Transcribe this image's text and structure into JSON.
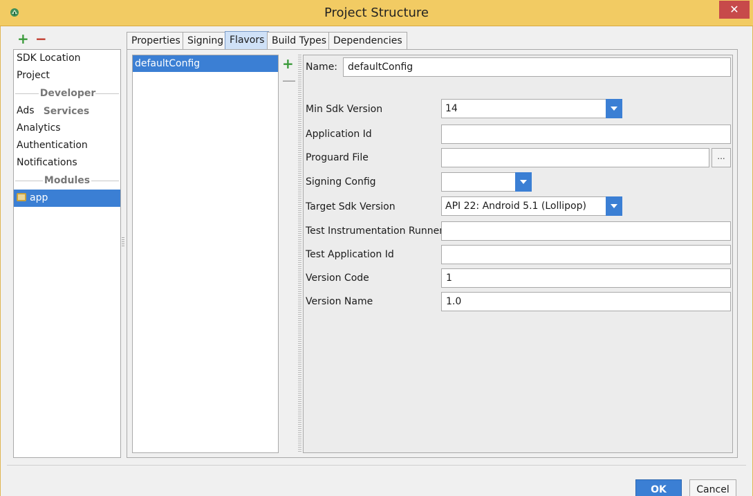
{
  "window": {
    "title": "Project Structure",
    "close_label": "✕"
  },
  "toolbar": {
    "add_label": "+",
    "remove_label": "−"
  },
  "nav": {
    "items": [
      {
        "label": "SDK Location"
      },
      {
        "label": "Project"
      }
    ],
    "section_developer": "Developer Services",
    "services": [
      {
        "label": "Ads"
      },
      {
        "label": "Analytics"
      },
      {
        "label": "Authentication"
      },
      {
        "label": "Notifications"
      }
    ],
    "section_modules": "Modules",
    "modules": [
      {
        "label": "app",
        "selected": true
      }
    ]
  },
  "tabs": [
    {
      "label": "Properties"
    },
    {
      "label": "Signing"
    },
    {
      "label": "Flavors",
      "active": true
    },
    {
      "label": "Build Types"
    },
    {
      "label": "Dependencies"
    }
  ],
  "flavors": {
    "items": [
      {
        "label": "defaultConfig",
        "selected": true
      }
    ],
    "add_label": "+",
    "remove_label": "—"
  },
  "form": {
    "name_label": "Name:",
    "name_value": "defaultConfig",
    "min_sdk_label": "Min Sdk Version",
    "min_sdk_value": "14",
    "app_id_label": "Application Id",
    "app_id_value": "",
    "proguard_label": "Proguard File",
    "proguard_value": "",
    "browse_label": "...",
    "signing_label": "Signing Config",
    "signing_value": "",
    "target_sdk_label": "Target Sdk Version",
    "target_sdk_value": "API 22: Android 5.1 (Lollipop)",
    "test_runner_label": "Test Instrumentation Runner",
    "test_runner_value": "",
    "test_app_id_label": "Test Application Id",
    "test_app_id_value": "",
    "version_code_label": "Version Code",
    "version_code_value": "1",
    "version_name_label": "Version Name",
    "version_name_value": "1.0"
  },
  "buttons": {
    "ok": "OK",
    "cancel": "Cancel"
  },
  "colors": {
    "titlebar": "#f2cb63",
    "close": "#c74a4a",
    "selection": "#3b7fd4",
    "add": "#3a9a3a",
    "remove": "#c0392b"
  },
  "icons": {
    "app_icon": "android-studio-icon",
    "module_icon": "module-folder-icon"
  }
}
